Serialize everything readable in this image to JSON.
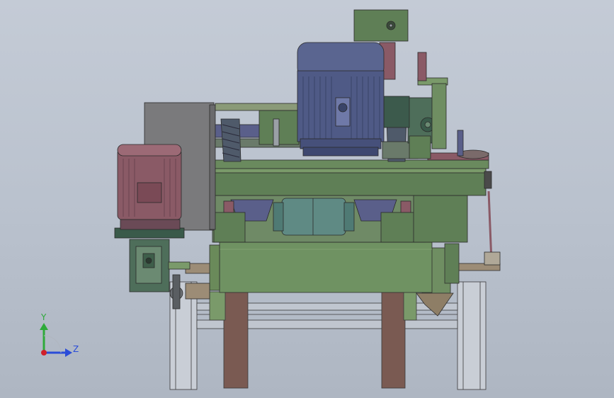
{
  "viewport": {
    "background_top": "#c4cbd6",
    "background_bottom": "#aeb6c2"
  },
  "triad": {
    "y_label": "Y",
    "z_label": "Z",
    "y_color": "#2eaa3a",
    "z_color": "#2a4cd8",
    "origin_color": "#d0202a"
  },
  "colors": {
    "frame_green": "#5f7f56",
    "frame_green_light": "#7a9a6a",
    "motor_blue": "#4f5a86",
    "motor_blue_light": "#6f79a8",
    "motor_red": "#8a5a66",
    "leg_brown": "#7a5a52",
    "teal": "#5f8a84",
    "box_gray": "#7a7a7c",
    "gearbox_dark": "#4e6e5a"
  }
}
